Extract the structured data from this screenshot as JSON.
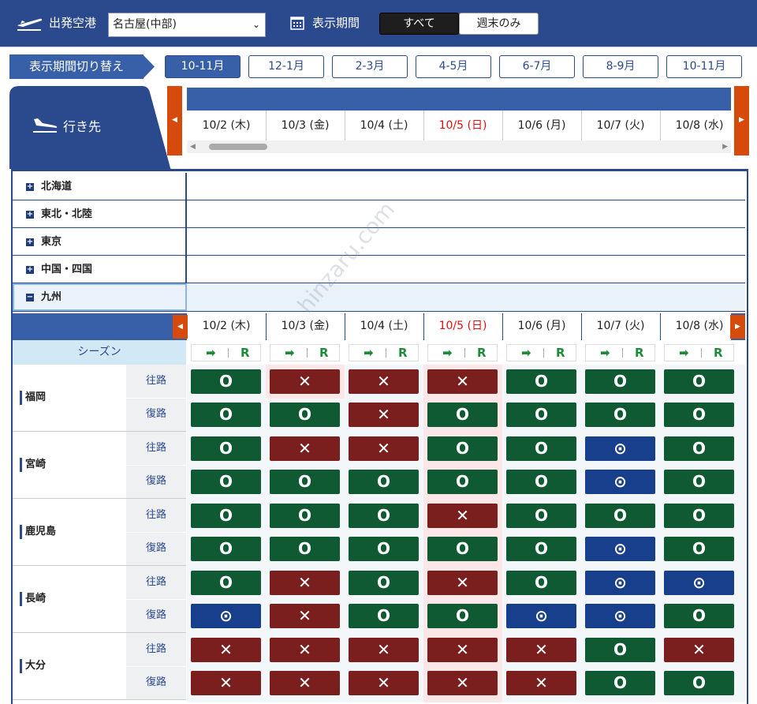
{
  "header": {
    "airport_label": "出発空港",
    "airport_value": "名古屋(中部)",
    "period_label": "表示期間",
    "toggle_all": "すべて",
    "toggle_weekend": "週末のみ"
  },
  "period_switch": {
    "label": "表示期間切り替え",
    "buttons": [
      "10-11月",
      "12-1月",
      "2-3月",
      "4-5月",
      "6-7月",
      "8-9月",
      "10-11月"
    ]
  },
  "destination_label": "行き先",
  "dates": [
    "10/2 (木)",
    "10/3 (金)",
    "10/4 (土)",
    "10/5 (日)",
    "10/6 (月)",
    "10/7 (火)",
    "10/8 (水)"
  ],
  "regions": [
    "北海道",
    "東北・北陸",
    "東京",
    "中国・四国",
    "九州"
  ],
  "season_label": "シーズン",
  "season_arrow": "➡",
  "season_r": "R",
  "dir_out": "往路",
  "dir_ret": "復路",
  "watermark": "hinzaru.com",
  "symbols": {
    "o": "O",
    "x": "✕",
    "d": "⊙"
  },
  "colors": {
    "o": "#0f5a32",
    "x": "#7a1e1e",
    "d": "#173f8c",
    "accent": "#2b4a8e",
    "sunday": "#d11111"
  },
  "cities": [
    {
      "name": "福岡",
      "out": [
        "o",
        "x",
        "x",
        "x",
        "o",
        "o",
        "o"
      ],
      "ret": [
        "o",
        "o",
        "x",
        "o",
        "o",
        "o",
        "o"
      ]
    },
    {
      "name": "宮崎",
      "out": [
        "o",
        "x",
        "x",
        "o",
        "o",
        "d",
        "o"
      ],
      "ret": [
        "o",
        "o",
        "o",
        "o",
        "o",
        "d",
        "o"
      ]
    },
    {
      "name": "鹿児島",
      "out": [
        "o",
        "o",
        "o",
        "x",
        "o",
        "o",
        "o"
      ],
      "ret": [
        "o",
        "o",
        "o",
        "o",
        "o",
        "d",
        "o"
      ]
    },
    {
      "name": "長崎",
      "out": [
        "o",
        "x",
        "o",
        "x",
        "o",
        "d",
        "d"
      ],
      "ret": [
        "d",
        "x",
        "o",
        "o",
        "d",
        "d",
        "o"
      ]
    },
    {
      "name": "大分",
      "out": [
        "x",
        "x",
        "x",
        "x",
        "x",
        "o",
        "x"
      ],
      "ret": [
        "x",
        "x",
        "x",
        "x",
        "x",
        "o",
        "o"
      ]
    }
  ]
}
